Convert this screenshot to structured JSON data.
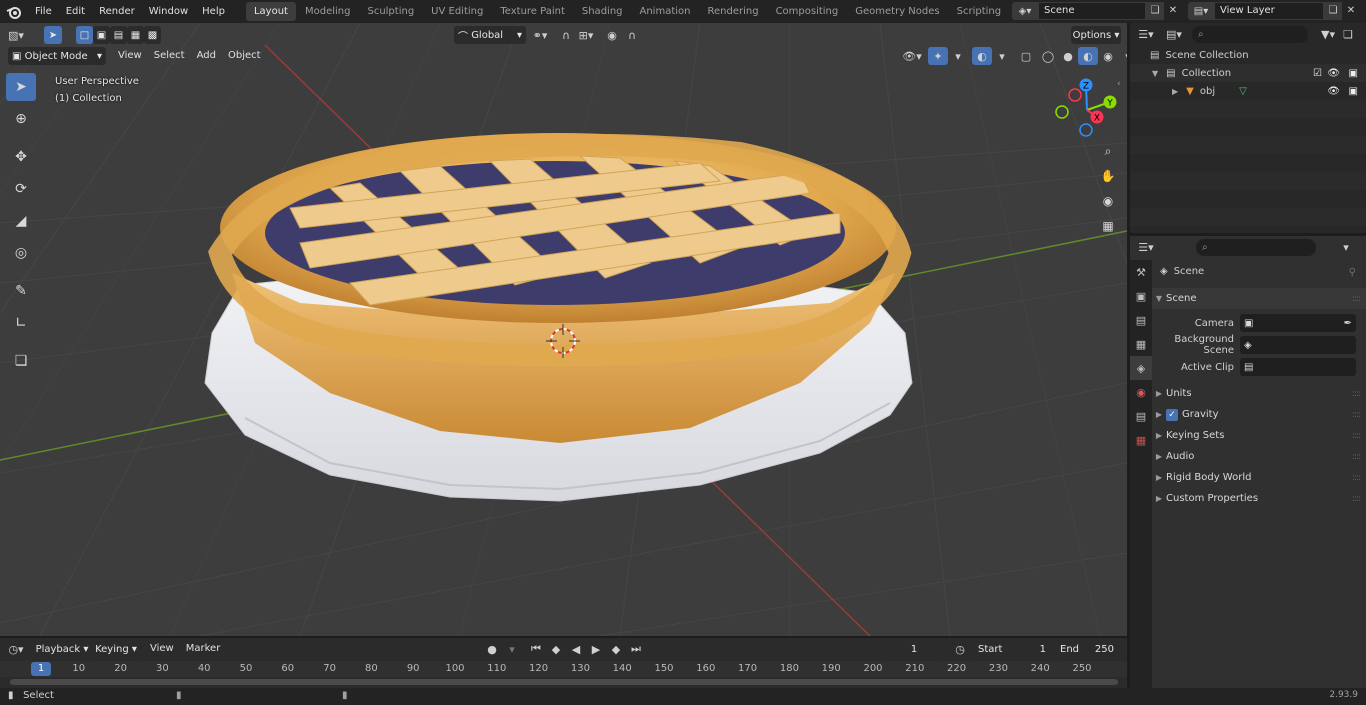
{
  "menubar": {
    "items": [
      "File",
      "Edit",
      "Render",
      "Window",
      "Help"
    ],
    "workspaces": [
      "Layout",
      "Modeling",
      "Sculpting",
      "UV Editing",
      "Texture Paint",
      "Shading",
      "Animation",
      "Rendering",
      "Compositing",
      "Geometry Nodes",
      "Scripting"
    ],
    "active_workspace": "Layout",
    "add_icon": "plus-icon",
    "scene_value": "Scene",
    "view_layer_value": "View Layer"
  },
  "viewport": {
    "mode": "Object Mode",
    "menus": [
      "View",
      "Select",
      "Add",
      "Object"
    ],
    "transform_orientation": "Global",
    "options_label": "Options",
    "overlay_line1": "User Perspective",
    "overlay_line2": "(1) Collection",
    "gizmo_axes": {
      "x": "X",
      "y": "Y",
      "z": "Z"
    },
    "tools": [
      "select-box-icon",
      "cursor-icon",
      "move-icon",
      "rotate-icon",
      "scale-icon",
      "transform-icon",
      "annotate-icon",
      "measure-icon",
      "add-cube-icon"
    ],
    "nav_icons": [
      "zoom-icon",
      "hand-pan-icon",
      "camera-icon",
      "grid-icon"
    ]
  },
  "timeline": {
    "menus": [
      "Playback",
      "Keying",
      "View",
      "Marker"
    ],
    "current_frame": "1",
    "start_label": "Start",
    "start_value": "1",
    "end_label": "End",
    "end_value": "250",
    "ruler_current": "1",
    "ruler_ticks": [
      "10",
      "20",
      "30",
      "40",
      "50",
      "60",
      "70",
      "80",
      "90",
      "100",
      "110",
      "120",
      "130",
      "140",
      "150",
      "160",
      "170",
      "180",
      "190",
      "200",
      "210",
      "220",
      "230",
      "240",
      "250"
    ]
  },
  "statusbar": {
    "left_label": "Select",
    "version": "2.93.9"
  },
  "outliner": {
    "scene_collection": "Scene Collection",
    "collection": "Collection",
    "object": "obj"
  },
  "properties": {
    "header": "Scene",
    "section": "Scene",
    "fields": [
      {
        "label": "Camera",
        "value": ""
      },
      {
        "label": "Background Scene",
        "value": ""
      },
      {
        "label": "Active Clip",
        "value": ""
      }
    ],
    "panels": [
      "Units",
      "Gravity",
      "Keying Sets",
      "Audio",
      "Rigid Body World",
      "Custom Properties"
    ],
    "gravity_checked": true
  },
  "colors": {
    "accent": "#4772b3",
    "x_axis": "#ff3352",
    "y_axis": "#8bdc00",
    "z_axis": "#2890ff"
  }
}
